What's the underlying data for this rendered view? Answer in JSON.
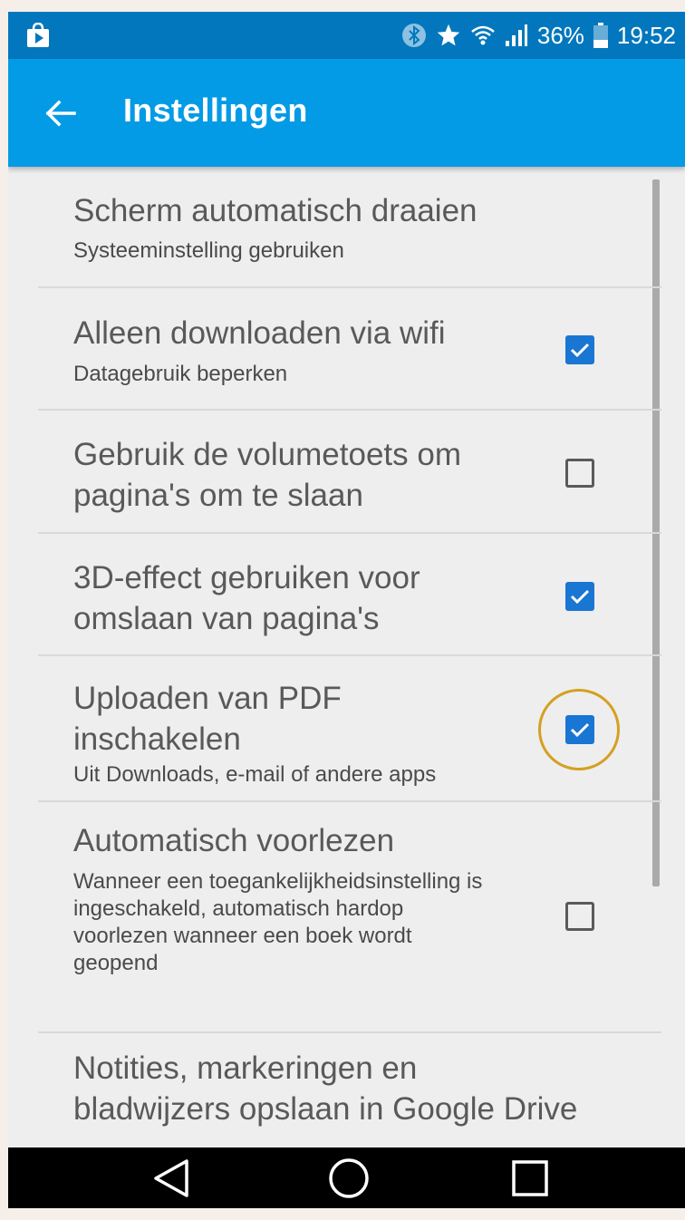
{
  "statusbar": {
    "battery": "36%",
    "time": "19:52",
    "icons": [
      "play-store-icon",
      "bluetooth-icon",
      "star-icon",
      "wifi-icon",
      "signal-icon",
      "battery-icon"
    ]
  },
  "appbar": {
    "title": "Instellingen",
    "back_icon": "back-arrow-icon"
  },
  "settings": [
    {
      "title": "Scherm automatisch draaien",
      "subtitle": "Systeeminstelling gebruiken",
      "checkbox": null
    },
    {
      "title": "Alleen downloaden via wifi",
      "subtitle": "Datagebruik beperken",
      "checkbox": true
    },
    {
      "title": "Gebruik de volumetoets om pagina's om te slaan",
      "subtitle": "",
      "checkbox": false
    },
    {
      "title": "3D-effect gebruiken voor omslaan van pagina's",
      "subtitle": "",
      "checkbox": true
    },
    {
      "title": "Uploaden van PDF inschakelen",
      "subtitle": "Uit Downloads, e-mail of andere apps",
      "checkbox": true,
      "highlighted": true
    },
    {
      "title": "Automatisch voorlezen",
      "subtitle": "Wanneer een toegankelijkheidsinstelling is ingeschakeld, automatisch hardop voorlezen wanneer een boek wordt geopend",
      "checkbox": false
    },
    {
      "title": "Notities, markeringen en bladwijzers opslaan in Google Drive",
      "subtitle": "",
      "checkbox": null
    }
  ],
  "navbar": {
    "icons": [
      "nav-back-icon",
      "nav-home-icon",
      "nav-recents-icon"
    ]
  },
  "colors": {
    "statusbar": "#0277bd",
    "appbar": "#039be5",
    "checkbox_on": "#1976d2",
    "highlight": "#d4a020",
    "background": "#eeeeee"
  }
}
